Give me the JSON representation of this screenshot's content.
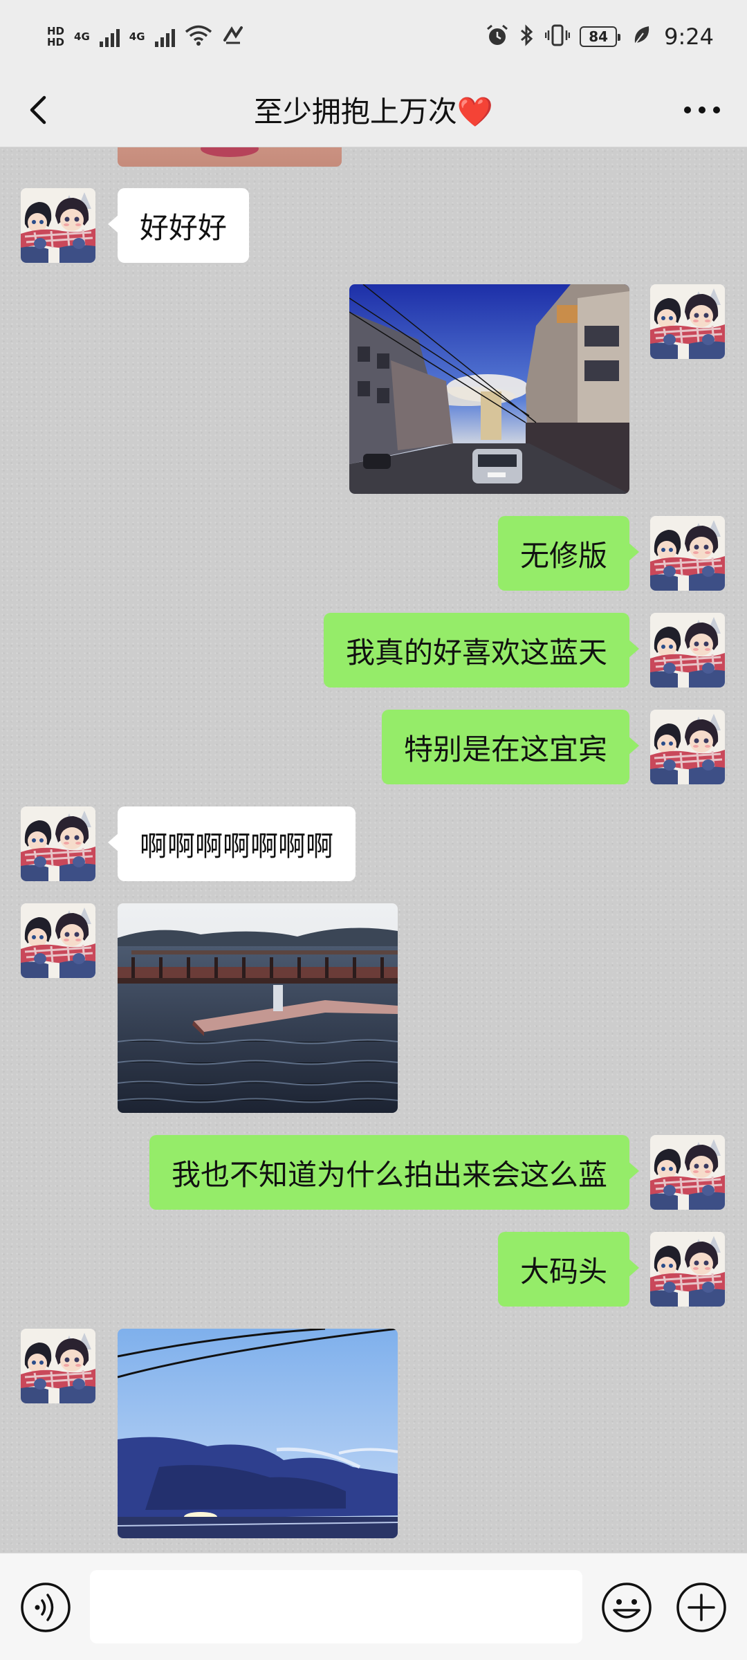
{
  "status_bar": {
    "hd_top": "HD",
    "hd_bottom": "HD",
    "net1": "4G",
    "net2": "4G",
    "battery": "84",
    "time": "9:24"
  },
  "header": {
    "title": "至少拥抱上万次❤️"
  },
  "messages": [
    {
      "side": "left",
      "type": "text",
      "text": "好好好"
    },
    {
      "side": "right",
      "type": "image",
      "subject": "street-photo"
    },
    {
      "side": "right",
      "type": "text",
      "text": "无修版"
    },
    {
      "side": "right",
      "type": "text",
      "text": "我真的好喜欢这蓝天"
    },
    {
      "side": "right",
      "type": "text",
      "text": "特别是在这宜宾"
    },
    {
      "side": "left",
      "type": "text",
      "text": "啊啊啊啊啊啊啊"
    },
    {
      "side": "left",
      "type": "image",
      "subject": "pier-photo"
    },
    {
      "side": "right",
      "type": "text",
      "text": "我也不知道为什么拍出来会这么蓝"
    },
    {
      "side": "right",
      "type": "text",
      "text": "大码头"
    },
    {
      "side": "left",
      "type": "image",
      "subject": "sky-photo"
    }
  ],
  "icons": [
    "back-arrow-icon",
    "more-icon",
    "voice-icon",
    "emoji-icon",
    "plus-icon",
    "alarm-icon",
    "bluetooth-icon",
    "vibrate-icon",
    "wifi-icon",
    "leaf-icon"
  ],
  "colors": {
    "header_bg": "#ededed",
    "out_bubble": "#95ec69",
    "in_bubble": "#ffffff",
    "input_bar": "#f6f6f6"
  }
}
